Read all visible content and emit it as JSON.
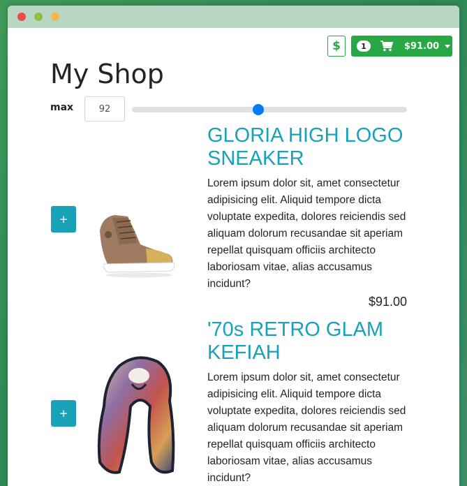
{
  "header": {
    "currency_symbol": "$",
    "cart_count": "1",
    "cart_total": "$91.00"
  },
  "shop": {
    "title": "My Shop",
    "max_label": "max",
    "max_value": "92",
    "slider_fraction": 0.46
  },
  "products": [
    {
      "add_label": "+",
      "title": "GLORIA HIGH LOGO SNEAKER",
      "description": "Lorem ipsum dolor sit, amet consectetur adipisicing elit. Aliquid tempore dicta voluptate expedita, dolores reiciendis sed aliquam dolorum recusandae sit aperiam repellat quisquam officiis architecto laboriosam vitae, alias accusamus incidunt?",
      "price": "$91.00"
    },
    {
      "add_label": "+",
      "title": "'70s RETRO GLAM KEFIAH",
      "description": "Lorem ipsum dolor sit, amet consectetur adipisicing elit. Aliquid tempore dicta voluptate expedita, dolores reiciendis sed aliquam dolorum recusandae sit aperiam repellat quisquam officiis architecto laboriosam vitae, alias accusamus incidunt?"
    }
  ],
  "colors": {
    "success": "#28a745",
    "info": "#17a2b8",
    "primary": "#007bff"
  }
}
